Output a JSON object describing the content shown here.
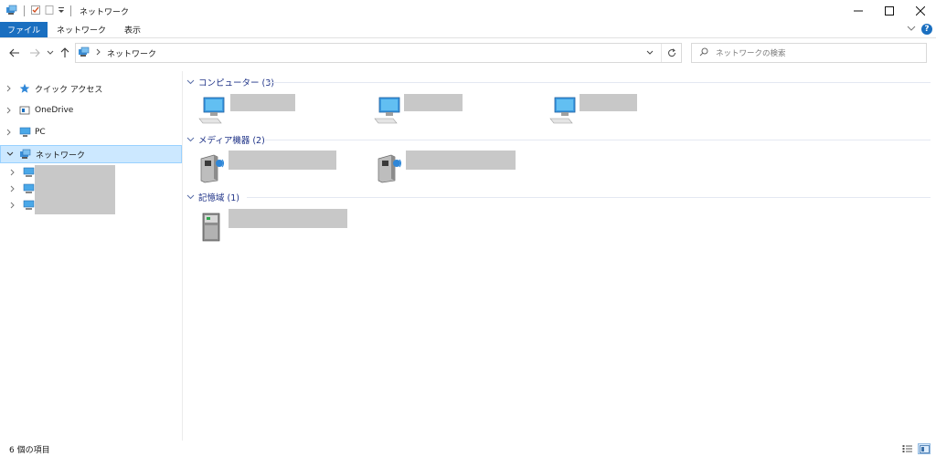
{
  "window": {
    "title": "ネットワーク"
  },
  "ribbon": {
    "tabs": [
      "ファイル",
      "ネットワーク",
      "表示"
    ]
  },
  "address": {
    "path": "ネットワーク"
  },
  "search": {
    "placeholder": "ネットワークの検索"
  },
  "nav": {
    "items": [
      {
        "label": "クイック アクセス",
        "icon": "star-icon"
      },
      {
        "label": "OneDrive",
        "icon": "onedrive-icon"
      },
      {
        "label": "PC",
        "icon": "pc-icon"
      },
      {
        "label": "ネットワーク",
        "icon": "network-icon"
      }
    ],
    "children": [
      {
        "icon": "computer-icon"
      },
      {
        "icon": "computer-icon"
      },
      {
        "icon": "computer-icon"
      }
    ]
  },
  "groups": [
    {
      "header": "コンピューター (3)",
      "icon": "computer-icon"
    },
    {
      "header": "メディア機器 (2)",
      "icon": "media-device-icon"
    },
    {
      "header": "記憶域 (1)",
      "icon": "storage-icon"
    }
  ],
  "status": {
    "count": "6 個の項目"
  },
  "colors": {
    "accent": "#1a6fc0",
    "group_header": "#1e3287",
    "selection": "#cce8ff"
  }
}
